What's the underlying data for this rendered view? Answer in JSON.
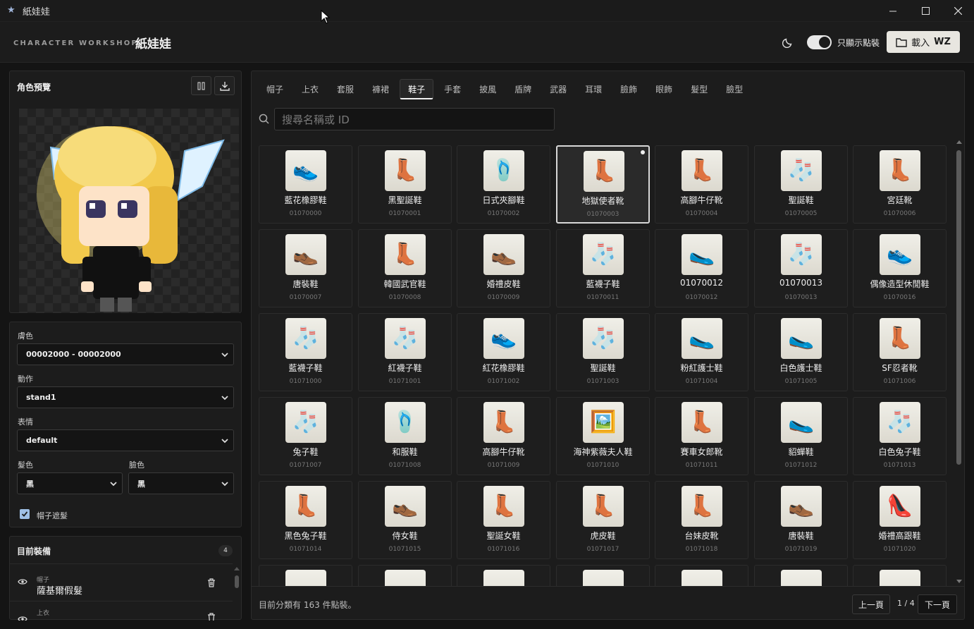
{
  "window": {
    "title": "紙娃娃",
    "icon": "star-icon"
  },
  "header": {
    "brand_sub": "CHARACTER WORKSHOP",
    "brand": "紙娃娃",
    "toggle_label": "只顯示點裝",
    "toggle_on": true,
    "load_button": "載入",
    "load_button_strong": "WZ"
  },
  "preview": {
    "title": "角色預覽"
  },
  "controls": {
    "skin_label": "膚色",
    "skin_value": "00002000 - 00002000",
    "action_label": "動作",
    "action_value": "stand1",
    "expression_label": "表情",
    "expression_value": "default",
    "hair_color_label": "髮色",
    "hair_color_value": "黑",
    "face_color_label": "臉色",
    "face_color_value": "黑",
    "hat_mask_label": "帽子遮髮",
    "hat_mask_checked": true
  },
  "equipped": {
    "title": "目前裝備",
    "count": "4",
    "items": [
      {
        "category": "帽子",
        "name": "薩基爾假髮"
      },
      {
        "category": "上衣",
        "name": ""
      }
    ]
  },
  "tabs": [
    "帽子",
    "上衣",
    "套服",
    "褲裙",
    "鞋子",
    "手套",
    "披風",
    "盾牌",
    "武器",
    "耳環",
    "臉飾",
    "眼飾",
    "髮型",
    "臉型"
  ],
  "active_tab": "鞋子",
  "search": {
    "placeholder": "搜尋名稱或 ID"
  },
  "items": [
    {
      "name": "藍花橡膠鞋",
      "id": "01070000",
      "icon": "👟"
    },
    {
      "name": "黑聖誕鞋",
      "id": "01070001",
      "icon": "👢"
    },
    {
      "name": "日式夾腳鞋",
      "id": "01070002",
      "icon": "🩴"
    },
    {
      "name": "地獄使者靴",
      "id": "01070003",
      "icon": "👢"
    },
    {
      "name": "高腳牛仔靴",
      "id": "01070004",
      "icon": "👢"
    },
    {
      "name": "聖誕鞋",
      "id": "01070005",
      "icon": "🧦"
    },
    {
      "name": "宮廷靴",
      "id": "01070006",
      "icon": "👢"
    },
    {
      "name": "唐裝鞋",
      "id": "01070007",
      "icon": "👞"
    },
    {
      "name": "韓國武官鞋",
      "id": "01070008",
      "icon": "👢"
    },
    {
      "name": "婚禮皮鞋",
      "id": "01070009",
      "icon": "👞"
    },
    {
      "name": "藍襪子鞋",
      "id": "01070011",
      "icon": "🧦"
    },
    {
      "name": "01070012",
      "id": "01070012",
      "icon": "🥿"
    },
    {
      "name": "01070013",
      "id": "01070013",
      "icon": "🧦"
    },
    {
      "name": "偶像造型休閒鞋",
      "id": "01070016",
      "icon": "👟"
    },
    {
      "name": "藍襪子鞋",
      "id": "01071000",
      "icon": "🧦"
    },
    {
      "name": "紅襪子鞋",
      "id": "01071001",
      "icon": "🧦"
    },
    {
      "name": "紅花橡膠鞋",
      "id": "01071002",
      "icon": "👟"
    },
    {
      "name": "聖誕鞋",
      "id": "01071003",
      "icon": "🧦"
    },
    {
      "name": "粉紅護士鞋",
      "id": "01071004",
      "icon": "🥿"
    },
    {
      "name": "白色護士鞋",
      "id": "01071005",
      "icon": "🥿"
    },
    {
      "name": "SF忍者靴",
      "id": "01071006",
      "icon": "👢"
    },
    {
      "name": "兔子鞋",
      "id": "01071007",
      "icon": "🧦"
    },
    {
      "name": "和服鞋",
      "id": "01071008",
      "icon": "🩴"
    },
    {
      "name": "高腳牛仔靴",
      "id": "01071009",
      "icon": "👢"
    },
    {
      "name": "海神紫薇夫人鞋",
      "id": "01071010",
      "icon": "🖼️"
    },
    {
      "name": "賽車女郎靴",
      "id": "01071011",
      "icon": "👢"
    },
    {
      "name": "貂蟬鞋",
      "id": "01071012",
      "icon": "🥿"
    },
    {
      "name": "白色兔子鞋",
      "id": "01071013",
      "icon": "🧦"
    },
    {
      "name": "黑色兔子鞋",
      "id": "01071014",
      "icon": "👢"
    },
    {
      "name": "侍女鞋",
      "id": "01071015",
      "icon": "👞"
    },
    {
      "name": "聖誕女鞋",
      "id": "01071016",
      "icon": "👢"
    },
    {
      "name": "虎皮鞋",
      "id": "01071017",
      "icon": "👢"
    },
    {
      "name": "台妹皮靴",
      "id": "01071018",
      "icon": "👢"
    },
    {
      "name": "唐裝鞋",
      "id": "01071019",
      "icon": "👞"
    },
    {
      "name": "婚禮高跟鞋",
      "id": "01071020",
      "icon": "👠"
    }
  ],
  "selected_item_id": "01070003",
  "footer": {
    "info": "目前分類有 163 件點裝。",
    "prev": "上一頁",
    "page": "1 / 4",
    "next": "下一頁"
  }
}
